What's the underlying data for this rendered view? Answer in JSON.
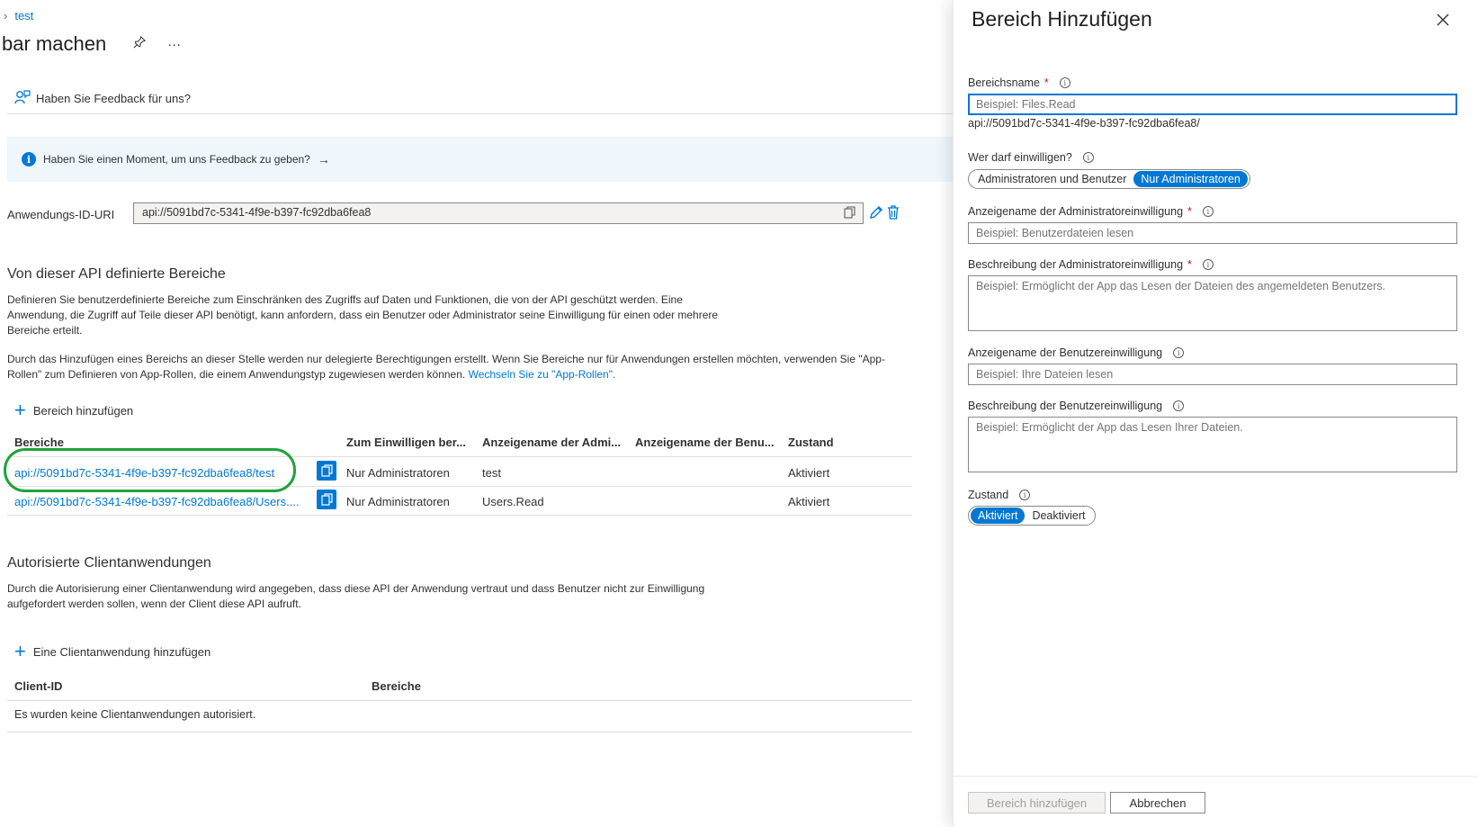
{
  "breadcrumb": {
    "item": "test"
  },
  "page": {
    "title": "bar machen"
  },
  "feedback": {
    "link_text": "Haben Sie Feedback für uns?"
  },
  "info_bar": {
    "text": "Haben Sie einen Moment, um uns Feedback zu geben?",
    "arrow": "→"
  },
  "app_uri": {
    "label": "Anwendungs-ID-URI",
    "value": "api://5091bd7c-5341-4f9e-b397-fc92dba6fea8"
  },
  "scopes_section": {
    "title": "Von dieser API definierte Bereiche",
    "para1": "Definieren Sie benutzerdefinierte Bereiche zum Einschränken des Zugriffs auf Daten und Funktionen, die von der API geschützt werden. Eine Anwendung, die Zugriff auf Teile dieser API benötigt, kann anfordern, dass ein Benutzer oder Administrator seine Einwilligung für einen oder mehrere Bereiche erteilt.",
    "para2": "Durch das Hinzufügen eines Bereichs an dieser Stelle werden nur delegierte Berechtigungen erstellt. Wenn Sie Bereiche nur für Anwendungen erstellen möchten, verwenden Sie \"App-Rollen\" zum Definieren von App-Rollen, die einem Anwendungstyp zugewiesen werden können.",
    "para2_link": "Wechseln Sie zu \"App-Rollen\".",
    "add_label": "Bereich hinzufügen",
    "columns": [
      "Bereiche",
      "Zum Einwilligen ber...",
      "Anzeigename der Admi...",
      "Anzeigename der Benu...",
      "Zustand"
    ],
    "rows": [
      {
        "scope": "api://5091bd7c-5341-4f9e-b397-fc92dba6fea8/test",
        "consent": "Nur Administratoren",
        "admin_name": "test",
        "user_name": "",
        "state": "Aktiviert"
      },
      {
        "scope": "api://5091bd7c-5341-4f9e-b397-fc92dba6fea8/Users....",
        "consent": "Nur Administratoren",
        "admin_name": "Users.Read",
        "user_name": "",
        "state": "Aktiviert"
      }
    ]
  },
  "clients_section": {
    "title": "Autorisierte Clientanwendungen",
    "para": "Durch die Autorisierung einer Clientanwendung wird angegeben, dass diese API der Anwendung vertraut und dass Benutzer nicht zur Einwilligung aufgefordert werden sollen, wenn der Client diese API aufruft.",
    "add_label": "Eine Clientanwendung hinzufügen",
    "columns": [
      "Client-ID",
      "Bereiche"
    ],
    "empty": "Es wurden keine Clientanwendungen autorisiert."
  },
  "panel": {
    "title": "Bereich Hinzufügen",
    "scope_name": {
      "label": "Bereichsname",
      "placeholder": "Beispiel: Files.Read",
      "prefix_hint": "api://5091bd7c-5341-4f9e-b397-fc92dba6fea8/"
    },
    "who_consent": {
      "label": "Wer darf einwilligen?",
      "options": [
        "Administratoren und Benutzer",
        "Nur Administratoren"
      ],
      "selected": "Nur Administratoren"
    },
    "admin_display": {
      "label": "Anzeigename der Administratoreinwilligung",
      "placeholder": "Beispiel: Benutzerdateien lesen"
    },
    "admin_desc": {
      "label": "Beschreibung der Administratoreinwilligung",
      "placeholder": "Beispiel: Ermöglicht der App das Lesen der Dateien des angemeldeten Benutzers."
    },
    "user_display": {
      "label": "Anzeigename der Benutzereinwilligung",
      "placeholder": "Beispiel: Ihre Dateien lesen"
    },
    "user_desc": {
      "label": "Beschreibung der Benutzereinwilligung",
      "placeholder": "Beispiel: Ermöglicht der App das Lesen Ihrer Dateien."
    },
    "state": {
      "label": "Zustand",
      "options": [
        "Aktiviert",
        "Deaktiviert"
      ],
      "selected": "Aktiviert"
    },
    "buttons": {
      "add": "Bereich hinzufügen",
      "cancel": "Abbrechen"
    },
    "required_mark": "*"
  },
  "colors": {
    "accent": "#0078d4",
    "highlight": "#1fa33a",
    "info_bg": "#eff6fc"
  }
}
